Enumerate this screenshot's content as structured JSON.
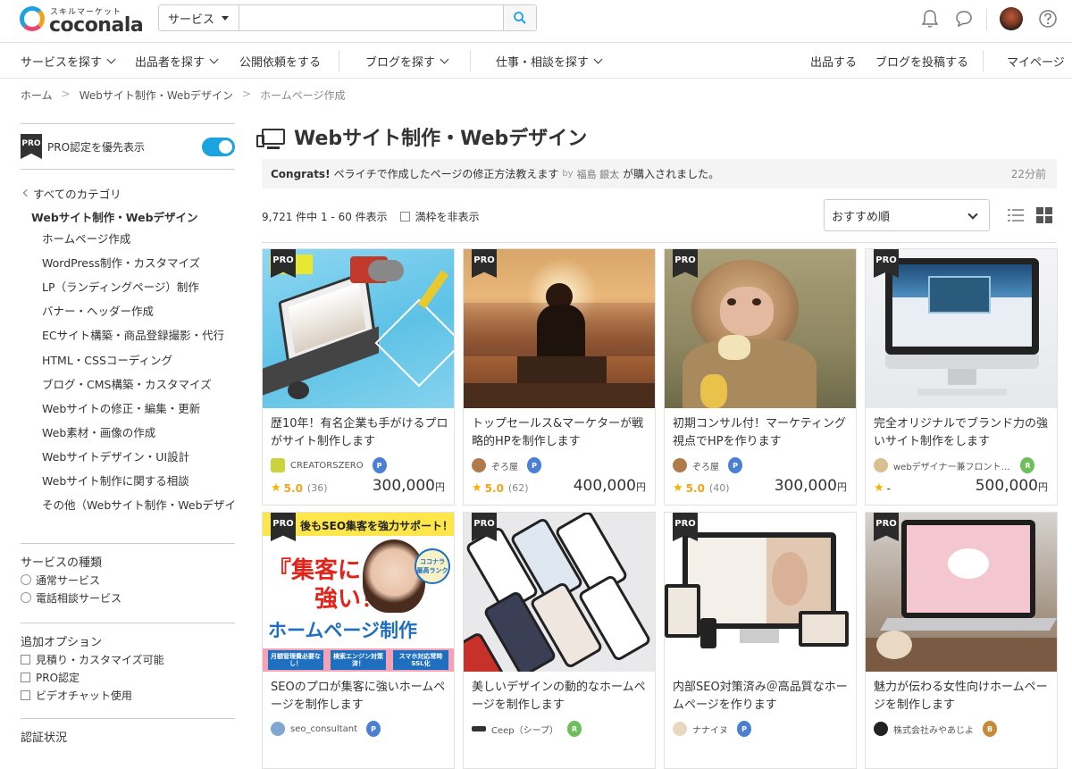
{
  "header": {
    "logo_sub": "スキルマーケット",
    "logo_name": "coconala",
    "search_category": "サービス",
    "search_placeholder": ""
  },
  "nav": {
    "items": [
      {
        "label": "サービスを探す"
      },
      {
        "label": "出品者を探す"
      },
      {
        "label": "公開依頼をする"
      },
      {
        "label": "ブログを探す"
      },
      {
        "label": "仕事・相談を探す"
      },
      {
        "label": "出品する"
      },
      {
        "label": "ブログを投稿する"
      },
      {
        "label": "マイページ"
      }
    ]
  },
  "breadcrumb": [
    "ホーム",
    "Webサイト制作・Webデザイン",
    "ホームページ作成"
  ],
  "sidebar": {
    "pro_badge": "PRO",
    "pro_label": "PRO認定を優先表示",
    "pro_toggle_on": true,
    "all_categories": "すべてのカテゴリ",
    "current": "Webサイト制作・Webデザイン",
    "subcategories": [
      "ホームページ作成",
      "WordPress制作・カスタマイズ",
      "LP（ランディングページ）制作",
      "バナー・ヘッダー作成",
      "ECサイト構築・商品登録撮影・代行",
      "HTML・CSSコーディング",
      "ブログ・CMS構築・カスタマイズ",
      "Webサイトの修正・編集・更新",
      "Web素材・画像の作成",
      "Webサイトデザイン・UI設計",
      "Webサイト制作に関する相談",
      "その他（Webサイト制作・Webデザイン"
    ],
    "service_type_title": "サービスの種類",
    "service_types": [
      "通常サービス",
      "電話相談サービス"
    ],
    "options_title": "追加オプション",
    "options": [
      "見積り・カスタマイズ可能",
      "PRO認定",
      "ビデオチャット使用"
    ],
    "cert_title": "認証状況"
  },
  "main": {
    "title": "Webサイト制作・Webデザイン",
    "congrats_label": "Congrats!",
    "congrats_text": "ペライチで作成したページの修正方法教えます",
    "congrats_by": "by",
    "congrats_user": "福島 銀太",
    "congrats_suffix": "が購入されました。",
    "congrats_time": "22分前",
    "result_count": "9,721 件中 1 - 60 件表示",
    "hide_full": "満枠を非表示",
    "sort": "おすすめ順"
  },
  "cards": [
    {
      "pro": "PRO",
      "title": "歴10年！有名企業も手がけるプロがサイト制作します",
      "seller": "CREATORSZERO",
      "rating": "5.0",
      "count": "(36)",
      "price": "300,000",
      "yen": "円",
      "rank_color": "#4a7fd4",
      "rank_letter": "P"
    },
    {
      "pro": "PRO",
      "title": "トップセールス&マーケターが戦略的HPを制作します",
      "seller": "ぞろ屋",
      "rating": "5.0",
      "count": "(62)",
      "price": "400,000",
      "yen": "円",
      "rank_color": "#4a7fd4",
      "rank_letter": "P"
    },
    {
      "pro": "PRO",
      "title": "初期コンサル付！マーケティング視点でHPを作ります",
      "seller": "ぞろ屋",
      "rating": "5.0",
      "count": "(40)",
      "price": "300,000",
      "yen": "円",
      "rank_color": "#4a7fd4",
      "rank_letter": "P"
    },
    {
      "pro": "PRO",
      "title": "完全オリジナルでブランド力の強いサイト制作をします",
      "seller": "webデザイナー兼フロント…",
      "rating": "-",
      "count": "",
      "price": "500,000",
      "yen": "円",
      "rank_color": "#6cbf5a",
      "rank_letter": "R"
    },
    {
      "pro": "PRO",
      "title": "SEOのプロが集客に強いホームページを制作します",
      "seller": "seo_consultant",
      "rating": "",
      "count": "",
      "price": "",
      "yen": "",
      "rank_color": "#4a7fd4",
      "rank_letter": "P"
    },
    {
      "pro": "PRO",
      "title": "美しいデザインの動的なホームページを制作します",
      "seller": "Ceep（シープ）",
      "rating": "",
      "count": "",
      "price": "",
      "yen": "",
      "rank_color": "#6cbf5a",
      "rank_letter": "R"
    },
    {
      "pro": "PRO",
      "title": "内部SEO対策済み＠高品質なホームページを作ります",
      "seller": "ナナイヌ",
      "rating": "",
      "count": "",
      "price": "",
      "yen": "",
      "rank_color": "#4a7fd4",
      "rank_letter": "P"
    },
    {
      "pro": "PRO",
      "title": "魅力が伝わる女性向けホームページを制作します",
      "seller": "株式会社みやあじよ",
      "rating": "",
      "count": "",
      "price": "",
      "yen": "",
      "rank_color": "#c9893a",
      "rank_letter": "B"
    }
  ],
  "banner": {
    "top": "後もSEO集客を強力サポート！",
    "big1": "『集客に",
    "big2": "強い！』",
    "hp": "ホームページ制作",
    "rank1": "ココナラ",
    "rank2": "最高ランク",
    "f1": "月額管理費必要なし！",
    "f2": "検索エンジン対策済！",
    "f3": "スマホ対応常時SSL化"
  },
  "colors": {
    "accent": "#1aa3e0",
    "star": "#f5b400"
  }
}
